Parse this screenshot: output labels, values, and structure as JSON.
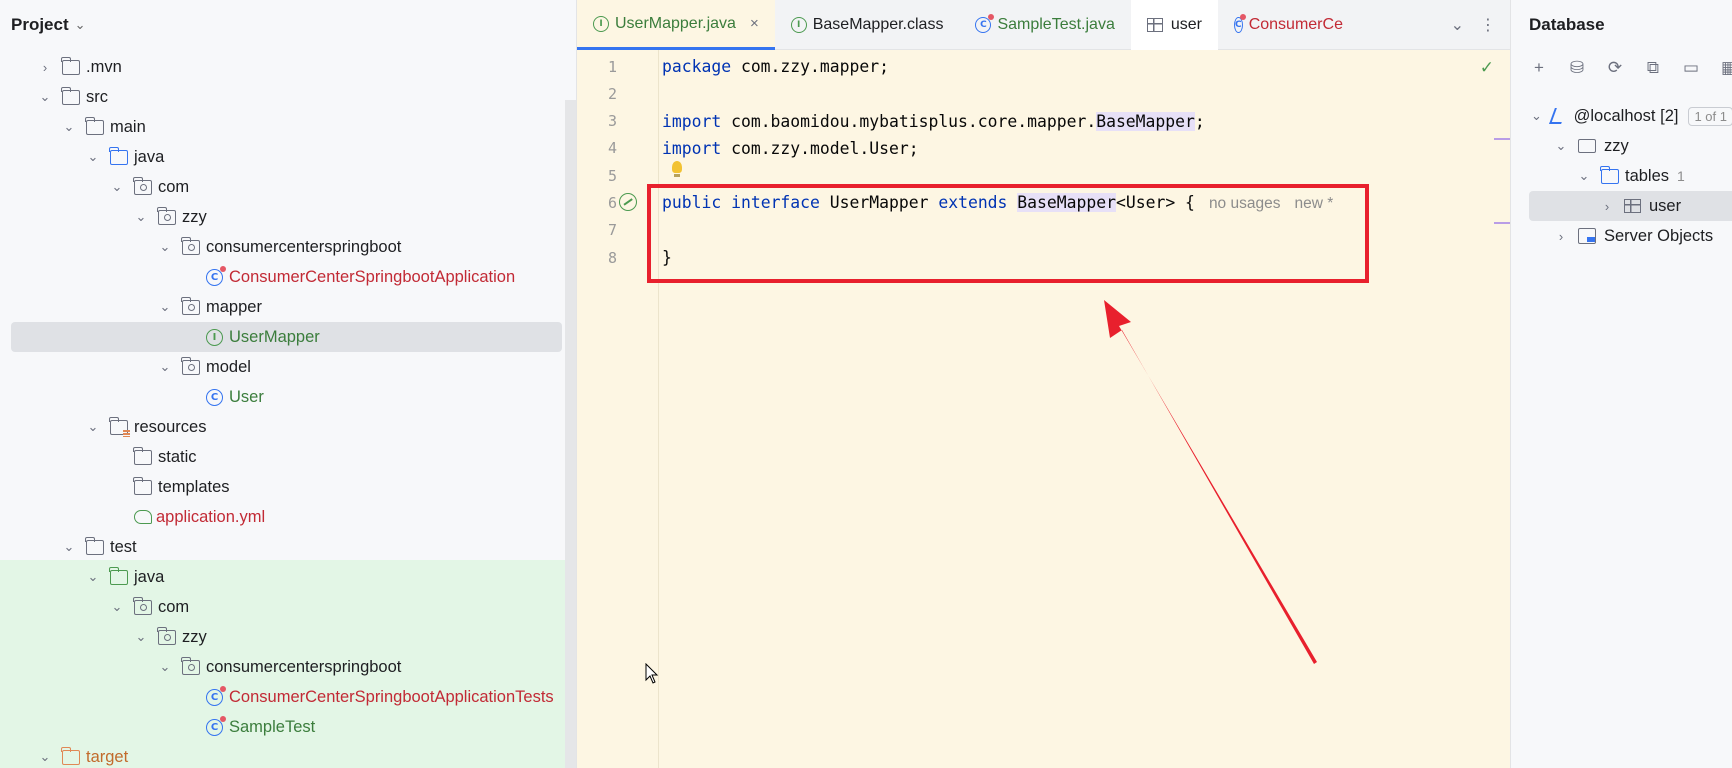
{
  "project": {
    "title": "Project",
    "tree": [
      {
        "label": ".mvn",
        "arrow": "›"
      },
      {
        "label": "src",
        "arrow": "⌄"
      },
      {
        "label": "main",
        "arrow": "⌄"
      },
      {
        "label": "java",
        "arrow": "⌄"
      },
      {
        "label": "com",
        "arrow": "⌄"
      },
      {
        "label": "zzy",
        "arrow": "⌄"
      },
      {
        "label": "consumercenterspringboot",
        "arrow": "⌄"
      },
      {
        "label": "ConsumerCenterSpringbootApplication"
      },
      {
        "label": "mapper",
        "arrow": "⌄"
      },
      {
        "label": "UserMapper"
      },
      {
        "label": "model",
        "arrow": "⌄"
      },
      {
        "label": "User"
      },
      {
        "label": "resources",
        "arrow": "⌄"
      },
      {
        "label": "static"
      },
      {
        "label": "templates"
      },
      {
        "label": "application.yml"
      },
      {
        "label": "test",
        "arrow": "⌄"
      },
      {
        "label": "java",
        "arrow": "⌄"
      },
      {
        "label": "com",
        "arrow": "⌄"
      },
      {
        "label": "zzy",
        "arrow": "⌄"
      },
      {
        "label": "consumercenterspringboot",
        "arrow": "⌄"
      },
      {
        "label": "ConsumerCenterSpringbootApplicationTests"
      },
      {
        "label": "SampleTest"
      },
      {
        "label": "target",
        "arrow": "⌄"
      }
    ]
  },
  "tabs": [
    {
      "label": "UserMapper.java",
      "icon": "I",
      "close": "×"
    },
    {
      "label": "BaseMapper.class",
      "icon": "I"
    },
    {
      "label": "SampleTest.java",
      "icon": "C"
    },
    {
      "label": "user"
    },
    {
      "label": "ConsumerCe"
    }
  ],
  "tab_tools": {
    "chevron": "⌄",
    "more": "⋮"
  },
  "editor": {
    "line_numbers": [
      "1",
      "2",
      "3",
      "4",
      "5",
      "6",
      "7",
      "8"
    ],
    "line1": {
      "kw": "package",
      "rest": " com.zzy.mapper;"
    },
    "line3": {
      "kw": "import",
      "a": " com.baomidou.mybatisplus.core.mapper.",
      "hl": "BaseMapper",
      "b": ";"
    },
    "line4": {
      "kw": "import",
      "rest": " com.zzy.model.User;"
    },
    "line6": {
      "kw1": "public",
      "kw2": "interface",
      "name": "UserMapper",
      "kw3": "extends",
      "hl": "BaseMapper",
      "rest": "<User> {",
      "hint1": "no usages",
      "hint2": "new *"
    },
    "line8": {
      "rest": "}"
    },
    "check": "✓"
  },
  "database": {
    "title": "Database",
    "toolbar": [
      "+",
      "⛁",
      "⟳",
      "⧉",
      "▭",
      "▦"
    ],
    "host": {
      "label": "@localhost",
      "count": "[2]",
      "badge": "1 of 1"
    },
    "schema": "zzy",
    "tables": {
      "label": "tables",
      "count": "1"
    },
    "table": "user",
    "server_objects": "Server Objects"
  },
  "colors": {
    "annotation": "#e8202d",
    "accent": "#3574f0"
  }
}
